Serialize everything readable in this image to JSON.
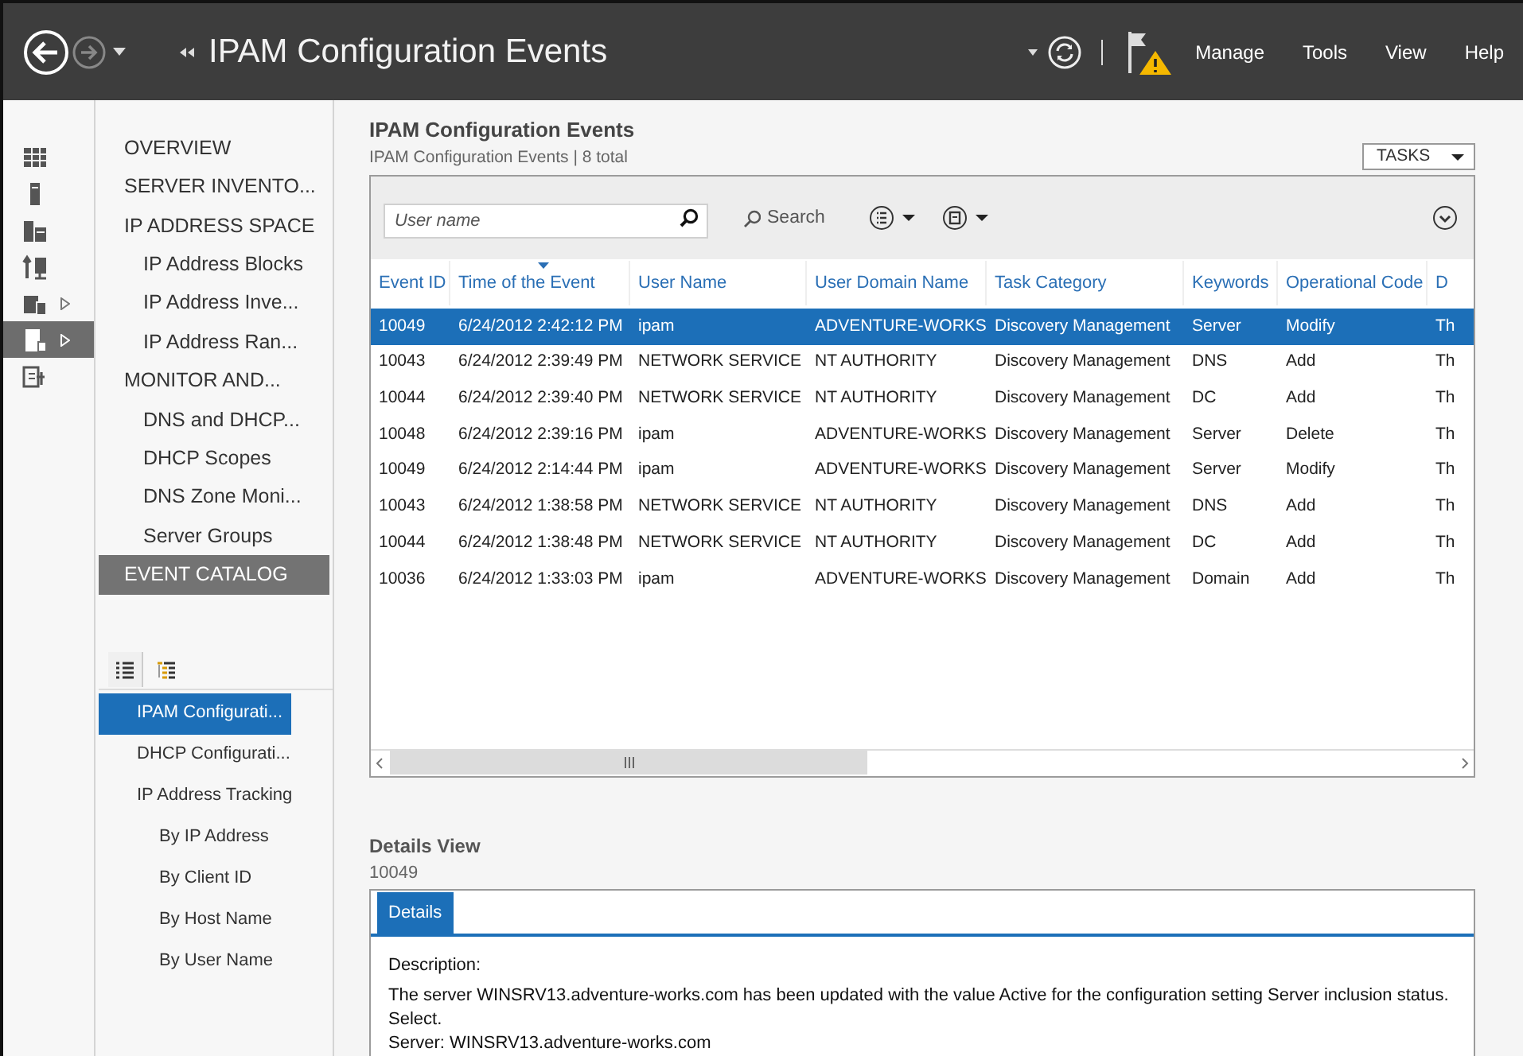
{
  "header": {
    "title": "IPAM Configuration Events",
    "menu": [
      "Manage",
      "Tools",
      "View",
      "Help"
    ]
  },
  "rail": [
    {
      "selected": false
    },
    {
      "selected": false
    },
    {
      "selected": false
    },
    {
      "selected": false
    },
    {
      "selected": false
    },
    {
      "selected": true
    },
    {
      "selected": false
    }
  ],
  "nav": [
    {
      "label": "OVERVIEW",
      "selected": false
    },
    {
      "label": "SERVER INVENTO...",
      "selected": false
    },
    {
      "label": "IP ADDRESS SPACE",
      "selected": false,
      "children": [
        {
          "label": "IP Address Blocks",
          "selected": false
        },
        {
          "label": "IP Address Inve...",
          "selected": false
        },
        {
          "label": "IP Address Ran...",
          "selected": false
        }
      ]
    },
    {
      "label": "MONITOR AND...",
      "selected": false,
      "children": [
        {
          "label": "DNS and DHCP...",
          "selected": false
        },
        {
          "label": "DHCP Scopes",
          "selected": false
        },
        {
          "label": "DNS Zone Moni...",
          "selected": false
        },
        {
          "label": "Server Groups",
          "selected": false
        }
      ]
    },
    {
      "label": "EVENT CATALOG",
      "selected": true
    }
  ],
  "view_tabs": [
    {
      "selected": true
    },
    {
      "selected": false
    }
  ],
  "catalog": [
    {
      "label": "IPAM Configurati...",
      "selected": true
    },
    {
      "label": "DHCP Configurati...",
      "selected": false
    },
    {
      "label": "IP Address Tracking",
      "selected": false,
      "children": [
        {
          "label": "By IP Address",
          "selected": false
        },
        {
          "label": "By Client ID",
          "selected": false
        },
        {
          "label": "By Host Name",
          "selected": false
        },
        {
          "label": "By User Name",
          "selected": false
        }
      ]
    }
  ],
  "content": {
    "title": "IPAM Configuration Events",
    "subtitle": "IPAM Configuration Events | 8 total",
    "tasks": "TASKS"
  },
  "toolbar": {
    "search_placeholder": "User name",
    "search_button": "Search"
  },
  "table": {
    "columns": [
      "Event ID",
      "Time of the Event",
      "User Name",
      "User Domain Name",
      "Task Category",
      "Keywords",
      "Operational Code",
      "D"
    ],
    "rows": [
      {
        "cells": [
          "10049",
          "6/24/2012 2:42:12 PM",
          "ipam",
          "ADVENTURE-WORKS",
          "Discovery Management",
          "Server",
          "Modify",
          "Th"
        ],
        "selected": true
      },
      {
        "cells": [
          "10043",
          "6/24/2012 2:39:49 PM",
          "NETWORK SERVICE",
          "NT AUTHORITY",
          "Discovery Management",
          "DNS",
          "Add",
          "Th"
        ],
        "selected": false
      },
      {
        "cells": [
          "10044",
          "6/24/2012 2:39:40 PM",
          "NETWORK SERVICE",
          "NT AUTHORITY",
          "Discovery Management",
          "DC",
          "Add",
          "Th"
        ],
        "selected": false
      },
      {
        "cells": [
          "10048",
          "6/24/2012 2:39:16 PM",
          "ipam",
          "ADVENTURE-WORKS",
          "Discovery Management",
          "Server",
          "Delete",
          "Th"
        ],
        "selected": false
      },
      {
        "cells": [
          "10049",
          "6/24/2012 2:14:44 PM",
          "ipam",
          "ADVENTURE-WORKS",
          "Discovery Management",
          "Server",
          "Modify",
          "Th"
        ],
        "selected": false
      },
      {
        "cells": [
          "10043",
          "6/24/2012 1:38:58 PM",
          "NETWORK SERVICE",
          "NT AUTHORITY",
          "Discovery Management",
          "DNS",
          "Add",
          "Th"
        ],
        "selected": false
      },
      {
        "cells": [
          "10044",
          "6/24/2012 1:38:48 PM",
          "NETWORK SERVICE",
          "NT AUTHORITY",
          "Discovery Management",
          "DC",
          "Add",
          "Th"
        ],
        "selected": false
      },
      {
        "cells": [
          "10036",
          "6/24/2012 1:33:03 PM",
          "ipam",
          "ADVENTURE-WORKS",
          "Discovery Management",
          "Domain",
          "Add",
          "Th"
        ],
        "selected": false
      }
    ]
  },
  "details": {
    "title": "Details View",
    "id": "10049",
    "tabs": [
      {
        "label": "Details",
        "selected": true
      }
    ],
    "lines": [
      "Description:",
      "The server WINSRV13.adventure-works.com has been updated with the value Active for the configuration setting Server inclusion status.",
      "Select.",
      "Server: WINSRV13.adventure-works.com"
    ]
  }
}
